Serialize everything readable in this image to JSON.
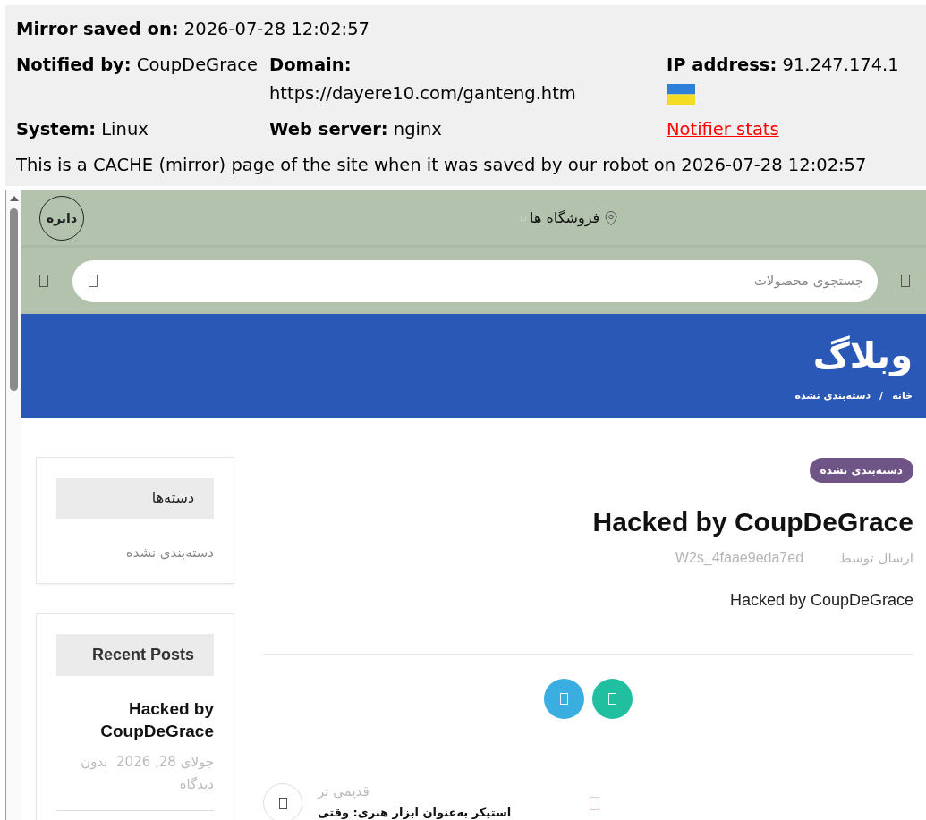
{
  "mirror_info": {
    "saved": {
      "label": "Mirror saved on:",
      "value": "2026-07-28 12:02:57"
    },
    "notifier": {
      "label": "Notified by:",
      "value": "CoupDeGrace"
    },
    "domain": {
      "label": "Domain:",
      "value": "https://dayere10.com/ganteng.htm"
    },
    "ip": {
      "label": "IP address:",
      "value": "91.247.174.1"
    },
    "system": {
      "label": "System:",
      "value": "Linux"
    },
    "web_server": {
      "label": "Web server:",
      "value": "nginx"
    },
    "stats_link": "Notifier stats",
    "note": "This is a CACHE (mirror) page of the site when it was saved by our robot on 2026-07-28 12:02:57"
  },
  "site": {
    "logo": {
      "text": "دایره"
    },
    "top_nav": [
      {
        "label": "فروشگاه ها"
      }
    ],
    "search": {
      "placeholder": "جستجوی محصولات"
    },
    "banner": {
      "title": "وبلاگ",
      "breadcrumb": [
        "خانه",
        "دسته‌بندی نشده"
      ],
      "separator": "/"
    },
    "sidebar": {
      "categories": {
        "title": "دسته‌ها",
        "items": [
          "دسته‌بندی نشده"
        ]
      },
      "recent_posts": {
        "title": "Recent Posts",
        "items": [
          {
            "title": "Hacked by CoupDeGrace",
            "meta": "جولای 28, 2026  بدون دیدگاه"
          }
        ]
      }
    },
    "post": {
      "category": "دسته‌بندی نشده",
      "title": "Hacked by CoupDeGrace",
      "author_label": "ارسال توسط",
      "author": "W2s_4faae9eda7ed",
      "body": "Hacked by CoupDeGrace",
      "share_buttons": [
        {
          "color": "#3aaee0"
        },
        {
          "color": "#20bf9f"
        }
      ],
      "nav": {
        "label": "قدیمی تر",
        "title": "استیکر به‌عنوان ابزار هنری: وقتی"
      }
    }
  }
}
